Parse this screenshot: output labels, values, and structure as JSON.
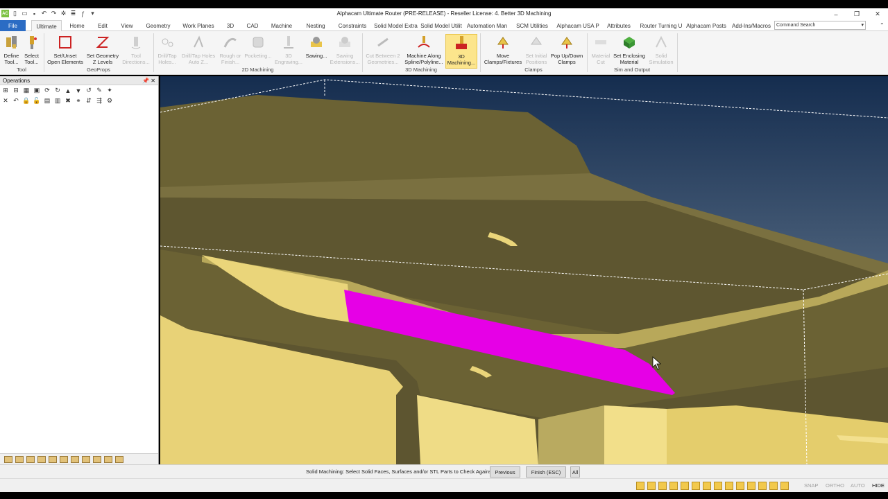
{
  "window": {
    "title": "Alphacam Ultimate Router (PRE-RELEASE) - Reseller License: 4. Better 3D Machining",
    "app_badge": "AC",
    "controls": [
      "–",
      "❐",
      "✕"
    ]
  },
  "tabs": [
    {
      "label": "File"
    },
    {
      "label": "Ultimate"
    },
    {
      "label": "Home"
    },
    {
      "label": "Edit"
    },
    {
      "label": "View"
    },
    {
      "label": "Geometry"
    },
    {
      "label": "Work Planes"
    },
    {
      "label": "3D"
    },
    {
      "label": "CAD"
    },
    {
      "label": "Machine"
    },
    {
      "label": "Nesting"
    },
    {
      "label": "Constraints"
    },
    {
      "label": "Solid Model Extra"
    },
    {
      "label": "Solid Model Utilit"
    },
    {
      "label": "Automation Man"
    },
    {
      "label": "SCM Utilities"
    },
    {
      "label": "Alphacam USA P"
    },
    {
      "label": "Attributes"
    },
    {
      "label": "Router Turning U"
    },
    {
      "label": "Alphacam Posts"
    },
    {
      "label": "Add-Ins/Macros"
    }
  ],
  "command_search": {
    "placeholder": "Command Search"
  },
  "ribbon": {
    "buttons": [
      {
        "label": "Define\nTool...",
        "icon": "define-tool-icon",
        "enabled": true
      },
      {
        "label": "Select\nTool...",
        "icon": "select-tool-icon",
        "enabled": true
      },
      {
        "label": "Set/Unset\nOpen Elements",
        "icon": "open-elements-icon",
        "enabled": true
      },
      {
        "label": "Set Geometry\nZ Levels",
        "icon": "z-levels-icon",
        "enabled": true
      },
      {
        "label": "Tool\nDirections...",
        "icon": "tool-directions-icon",
        "enabled": false
      },
      {
        "label": "Drill/Tap\nHoles...",
        "icon": "drill-tap-icon",
        "enabled": false
      },
      {
        "label": "Drill/Tap Holes\nAuto Z...",
        "icon": "drill-auto-icon",
        "enabled": false
      },
      {
        "label": "Rough or\nFinish...",
        "icon": "rough-finish-icon",
        "enabled": false
      },
      {
        "label": "Pocketing...",
        "icon": "pocketing-icon",
        "enabled": false
      },
      {
        "label": "3D\nEngraving...",
        "icon": "engraving-icon",
        "enabled": false
      },
      {
        "label": "Sawing...",
        "icon": "sawing-icon",
        "enabled": true
      },
      {
        "label": "Sawing\nExtensions...",
        "icon": "sawing-ext-icon",
        "enabled": false
      },
      {
        "label": "Cut Between 2\nGeometries...",
        "icon": "cut-between-icon",
        "enabled": false
      },
      {
        "label": "Machine Along\nSpline/Polyline...",
        "icon": "machine-along-icon",
        "enabled": true
      },
      {
        "label": "3D\nMachining...",
        "icon": "3d-machining-icon",
        "enabled": true
      },
      {
        "label": "Move\nClamps/Fixtures",
        "icon": "move-clamps-icon",
        "enabled": true
      },
      {
        "label": "Set Initial\nPositions",
        "icon": "initial-positions-icon",
        "enabled": false
      },
      {
        "label": "Pop Up/Down\nClamps",
        "icon": "popup-clamps-icon",
        "enabled": true
      },
      {
        "label": "Material\nCut",
        "icon": "material-cut-icon",
        "enabled": false
      },
      {
        "label": "Set Enclosing\nMaterial",
        "icon": "enclosing-material-icon",
        "enabled": true
      },
      {
        "label": "Solid\nSimulation",
        "icon": "solid-simulation-icon",
        "enabled": false
      }
    ],
    "groups": [
      "Tool",
      "GeoProps",
      "2D Machining",
      "3D Machining",
      "Clamps",
      "Sim and Output"
    ]
  },
  "operations_panel": {
    "title": "Operations",
    "pin": "📌",
    "close": "✕"
  },
  "status": {
    "message": "Solid Machining: Select Solid Faces, Surfaces and/or STL Parts to Check Against",
    "buttons": [
      "Previous",
      "Finish (ESC)",
      "All"
    ]
  },
  "bottom_modes": [
    "SNAP",
    "ORTHO",
    "AUTO",
    "HIDE"
  ],
  "colors": {
    "accent": "#2b6cc4",
    "selected_face": "#e600e6",
    "model": "#ead57a",
    "model_shadow": "#6b6234",
    "background_top": "#152d4f",
    "background_bottom": "#7f92a4"
  }
}
